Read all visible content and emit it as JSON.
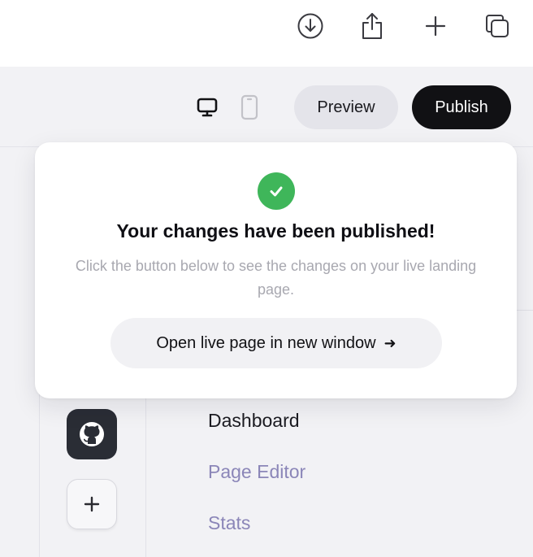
{
  "browser_toolbar": {
    "icons": [
      "download-icon",
      "share-icon",
      "new-tab-plus-icon",
      "tabs-overview-icon"
    ]
  },
  "editor_toolbar": {
    "device_icons": [
      "desktop-view-icon",
      "mobile-view-icon"
    ],
    "preview_label": "Preview",
    "publish_label": "Publish"
  },
  "popover": {
    "title": "Your changes have been published!",
    "description": "Click the button below to see the changes on your live landing page.",
    "open_button_label": "Open live page in new window",
    "open_button_arrow": "➜"
  },
  "sidebar": {
    "icons": [
      "github-icon",
      "add-icon"
    ],
    "nav_items": [
      {
        "label": "Dashboard"
      },
      {
        "label": "Page Editor"
      },
      {
        "label": "Stats"
      }
    ]
  },
  "colors": {
    "success": "#3fb65a",
    "publish_bg": "#111114",
    "nav_muted": "#8b86b8",
    "background": "#f2f2f5"
  }
}
